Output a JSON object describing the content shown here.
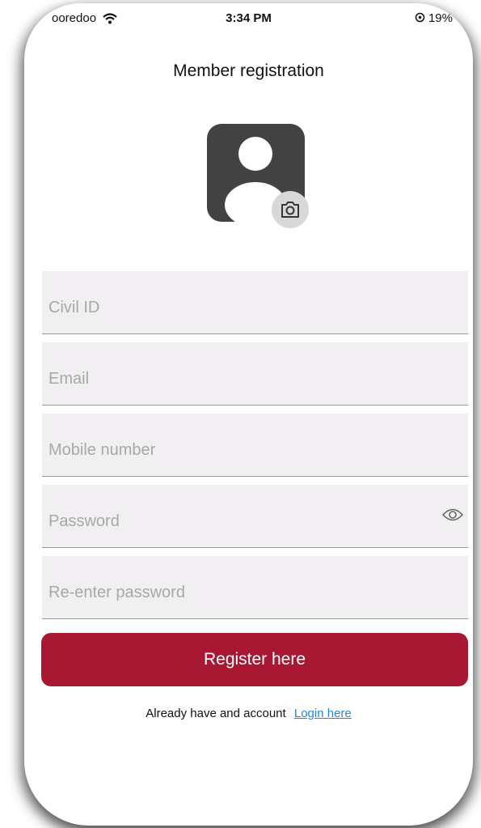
{
  "status_bar": {
    "carrier": "ooredoo",
    "time": "3:34 PM",
    "battery": "19%"
  },
  "header": {
    "title": "Member registration"
  },
  "avatar": {
    "icon": "user-placeholder-icon",
    "camera_icon": "camera-icon"
  },
  "form": {
    "civil_id": {
      "placeholder": "Civil ID",
      "value": ""
    },
    "email": {
      "placeholder": "Email",
      "value": ""
    },
    "mobile": {
      "placeholder": "Mobile number",
      "value": ""
    },
    "password": {
      "placeholder": "Password",
      "value": ""
    },
    "reenter_password": {
      "placeholder": "Re-enter password",
      "value": ""
    }
  },
  "actions": {
    "register_label": "Register here",
    "login_prompt": "Already have and account",
    "login_link": "Login here"
  },
  "colors": {
    "primary": "#a81833",
    "field_bg": "#f1eff1",
    "avatar_bg": "#424242",
    "link": "#1e88e5"
  }
}
